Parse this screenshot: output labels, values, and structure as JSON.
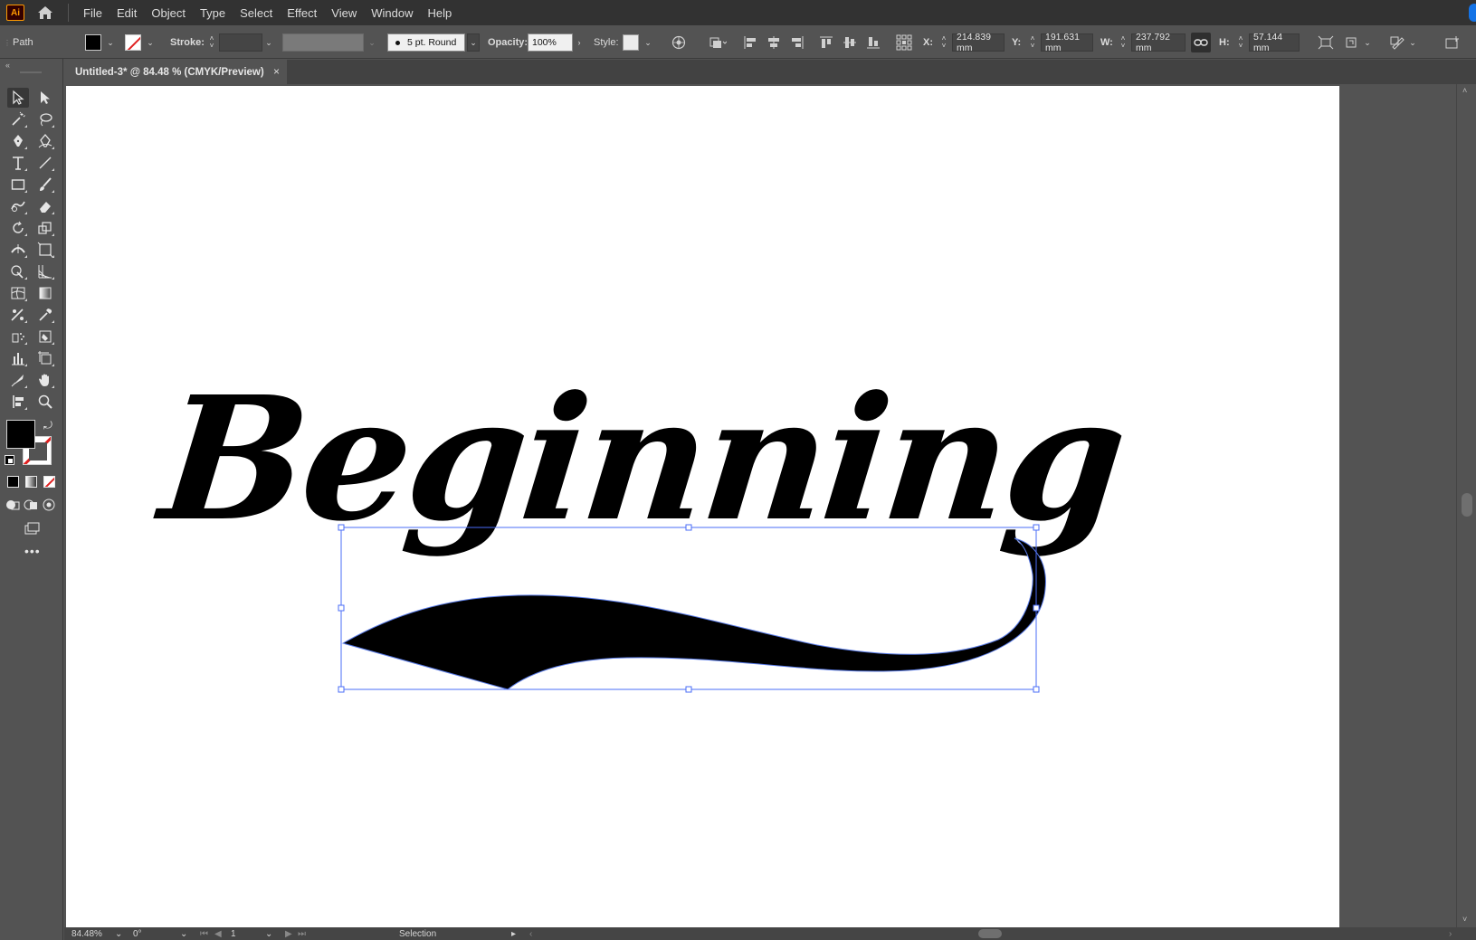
{
  "app": {
    "logo": "Ai",
    "home_icon": "home-icon"
  },
  "menu": [
    "File",
    "Edit",
    "Object",
    "Type",
    "Select",
    "Effect",
    "View",
    "Window",
    "Help"
  ],
  "control": {
    "object_type": "Path",
    "stroke_label": "Stroke:",
    "brush": "5 pt. Round",
    "opacity_label": "Opacity:",
    "opacity": "100%",
    "style_label": "Style:",
    "x_label": "X:",
    "x": "214.839 mm",
    "y_label": "Y:",
    "y": "191.631 mm",
    "w_label": "W:",
    "w": "237.792 mm",
    "h_label": "H:",
    "h": "57.144 mm"
  },
  "tab": {
    "title": "Untitled-3* @ 84.48 % (CMYK/Preview)",
    "close": "×"
  },
  "artwork": {
    "text": "Beginning"
  },
  "status": {
    "zoom": "84.48%",
    "rotation": "0°",
    "artboard": "1",
    "tool": "Selection"
  },
  "colors": {
    "fill": "#000000",
    "stroke": "none",
    "selection": "#4a6cf7",
    "accent": "#ff9a00"
  }
}
